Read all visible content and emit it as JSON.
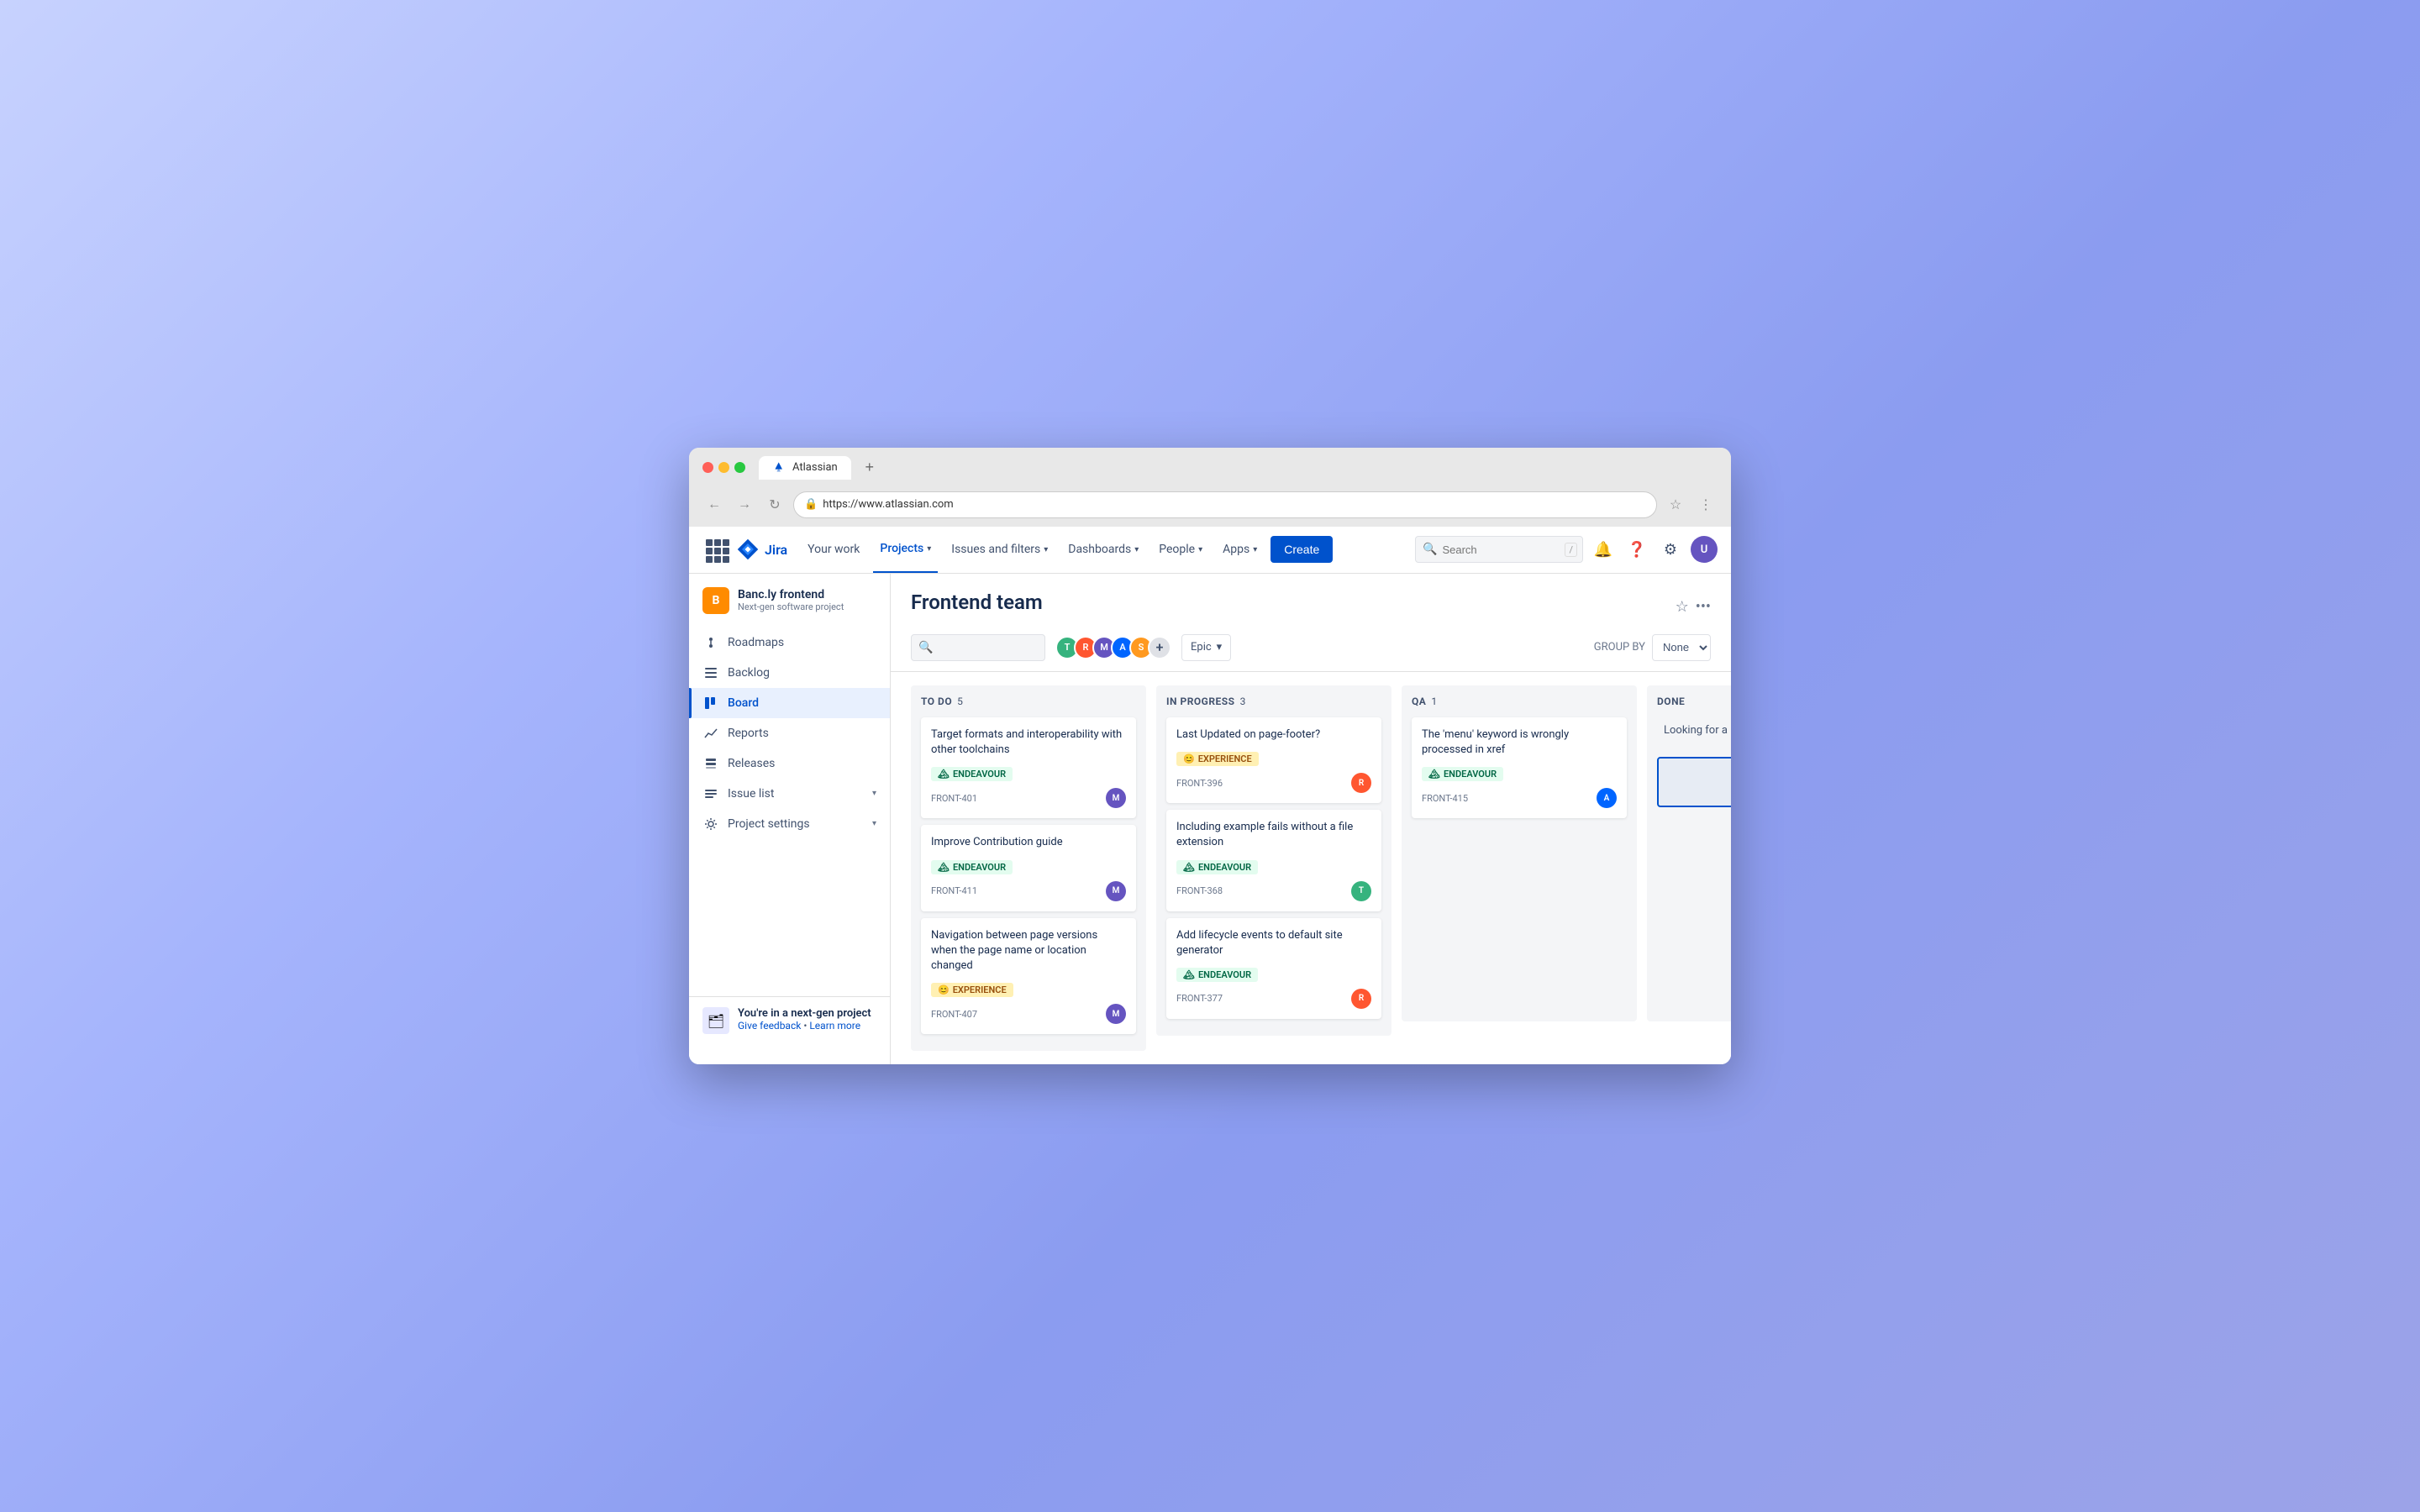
{
  "browser": {
    "tab_title": "Atlassian",
    "url": "https://www.atlassian.com",
    "new_tab_label": "+",
    "back_label": "←",
    "forward_label": "→",
    "refresh_label": "↻",
    "star_label": "☆",
    "more_label": "⋮"
  },
  "nav": {
    "grid_icon": "grid",
    "logo_text": "Jira",
    "your_work": "Your work",
    "projects": "Projects",
    "issues_filters": "Issues and filters",
    "dashboards": "Dashboards",
    "people": "People",
    "apps": "Apps",
    "create": "Create",
    "search_placeholder": "Search",
    "search_shortcut": "/",
    "notifications_icon": "bell",
    "help_icon": "question",
    "settings_icon": "gear",
    "user_initials": "U"
  },
  "sidebar": {
    "project_name": "Banc.ly frontend",
    "project_type": "Next-gen software project",
    "project_icon": "B",
    "items": [
      {
        "id": "roadmaps",
        "label": "Roadmaps",
        "icon": "⋮"
      },
      {
        "id": "backlog",
        "label": "Backlog",
        "icon": "☰"
      },
      {
        "id": "board",
        "label": "Board",
        "icon": "⊞",
        "active": true
      },
      {
        "id": "reports",
        "label": "Reports",
        "icon": "📈"
      },
      {
        "id": "releases",
        "label": "Releases",
        "icon": "🗂"
      },
      {
        "id": "issue-list",
        "label": "Issue list",
        "icon": "☰"
      },
      {
        "id": "project-settings",
        "label": "Project settings",
        "icon": "⚙"
      }
    ],
    "footer_title": "You're in a next-gen project",
    "footer_feedback": "Give feedback",
    "footer_learn": "Learn more"
  },
  "board": {
    "title": "Frontend team",
    "search_placeholder": "",
    "epic_filter": "Epic",
    "group_by_label": "GROUP BY",
    "group_by_value": "None",
    "avatars": [
      {
        "id": "av1",
        "initials": "T",
        "color": "#36b37e"
      },
      {
        "id": "av2",
        "initials": "R",
        "color": "#ff5630"
      },
      {
        "id": "av3",
        "initials": "M",
        "color": "#6554c0"
      },
      {
        "id": "av4",
        "initials": "A",
        "color": "#0065ff"
      },
      {
        "id": "av5",
        "initials": "S",
        "color": "#ff991f"
      },
      {
        "id": "av6",
        "initials": "+",
        "color": "#dfe1e6"
      }
    ],
    "columns": [
      {
        "id": "todo",
        "title": "TO DO",
        "count": 5,
        "cards": [
          {
            "id": "card-401",
            "title": "Target formats and interoperability with other toolchains",
            "epic": "ENDEAVOUR",
            "epic_type": "endeavour",
            "ticket": "FRONT-401",
            "assignee_color": "#6554c0",
            "assignee_initials": "M"
          },
          {
            "id": "card-411",
            "title": "Improve Contribution guide",
            "epic": "ENDEAVOUR",
            "epic_type": "endeavour",
            "ticket": "FRONT-411",
            "assignee_color": "#6554c0",
            "assignee_initials": "M"
          },
          {
            "id": "card-407",
            "title": "Navigation between page versions when the page name or location changed",
            "epic": "EXPERIENCE",
            "epic_type": "experience",
            "ticket": "FRONT-407",
            "assignee_color": "#6554c0",
            "assignee_initials": "M"
          }
        ]
      },
      {
        "id": "in-progress",
        "title": "IN PROGRESS",
        "count": 3,
        "cards": [
          {
            "id": "card-396",
            "title": "Last Updated on page-footer?",
            "epic": "EXPERIENCE",
            "epic_type": "experience",
            "ticket": "FRONT-396",
            "assignee_color": "#ff5630",
            "assignee_initials": "R"
          },
          {
            "id": "card-368",
            "title": "Including example fails without a file extension",
            "epic": "ENDEAVOUR",
            "epic_type": "endeavour",
            "ticket": "FRONT-368",
            "assignee_color": "#36b37e",
            "assignee_initials": "T"
          },
          {
            "id": "card-377",
            "title": "Add lifecycle events to default site generator",
            "epic": "ENDEAVOUR",
            "epic_type": "endeavour",
            "ticket": "FRONT-377",
            "assignee_color": "#ff5630",
            "assignee_initials": "R"
          }
        ]
      },
      {
        "id": "qa",
        "title": "QA",
        "count": 1,
        "cards": [
          {
            "id": "card-415",
            "title": "The 'menu' keyword is wrongly processed in xref",
            "epic": "ENDEAVOUR",
            "epic_type": "endeavour",
            "ticket": "FRONT-415",
            "assignee_color": "#0065ff",
            "assignee_initials": "A"
          }
        ]
      },
      {
        "id": "done",
        "title": "DONE",
        "count": null,
        "cards": [],
        "partial_text": "Looking for a"
      }
    ]
  }
}
